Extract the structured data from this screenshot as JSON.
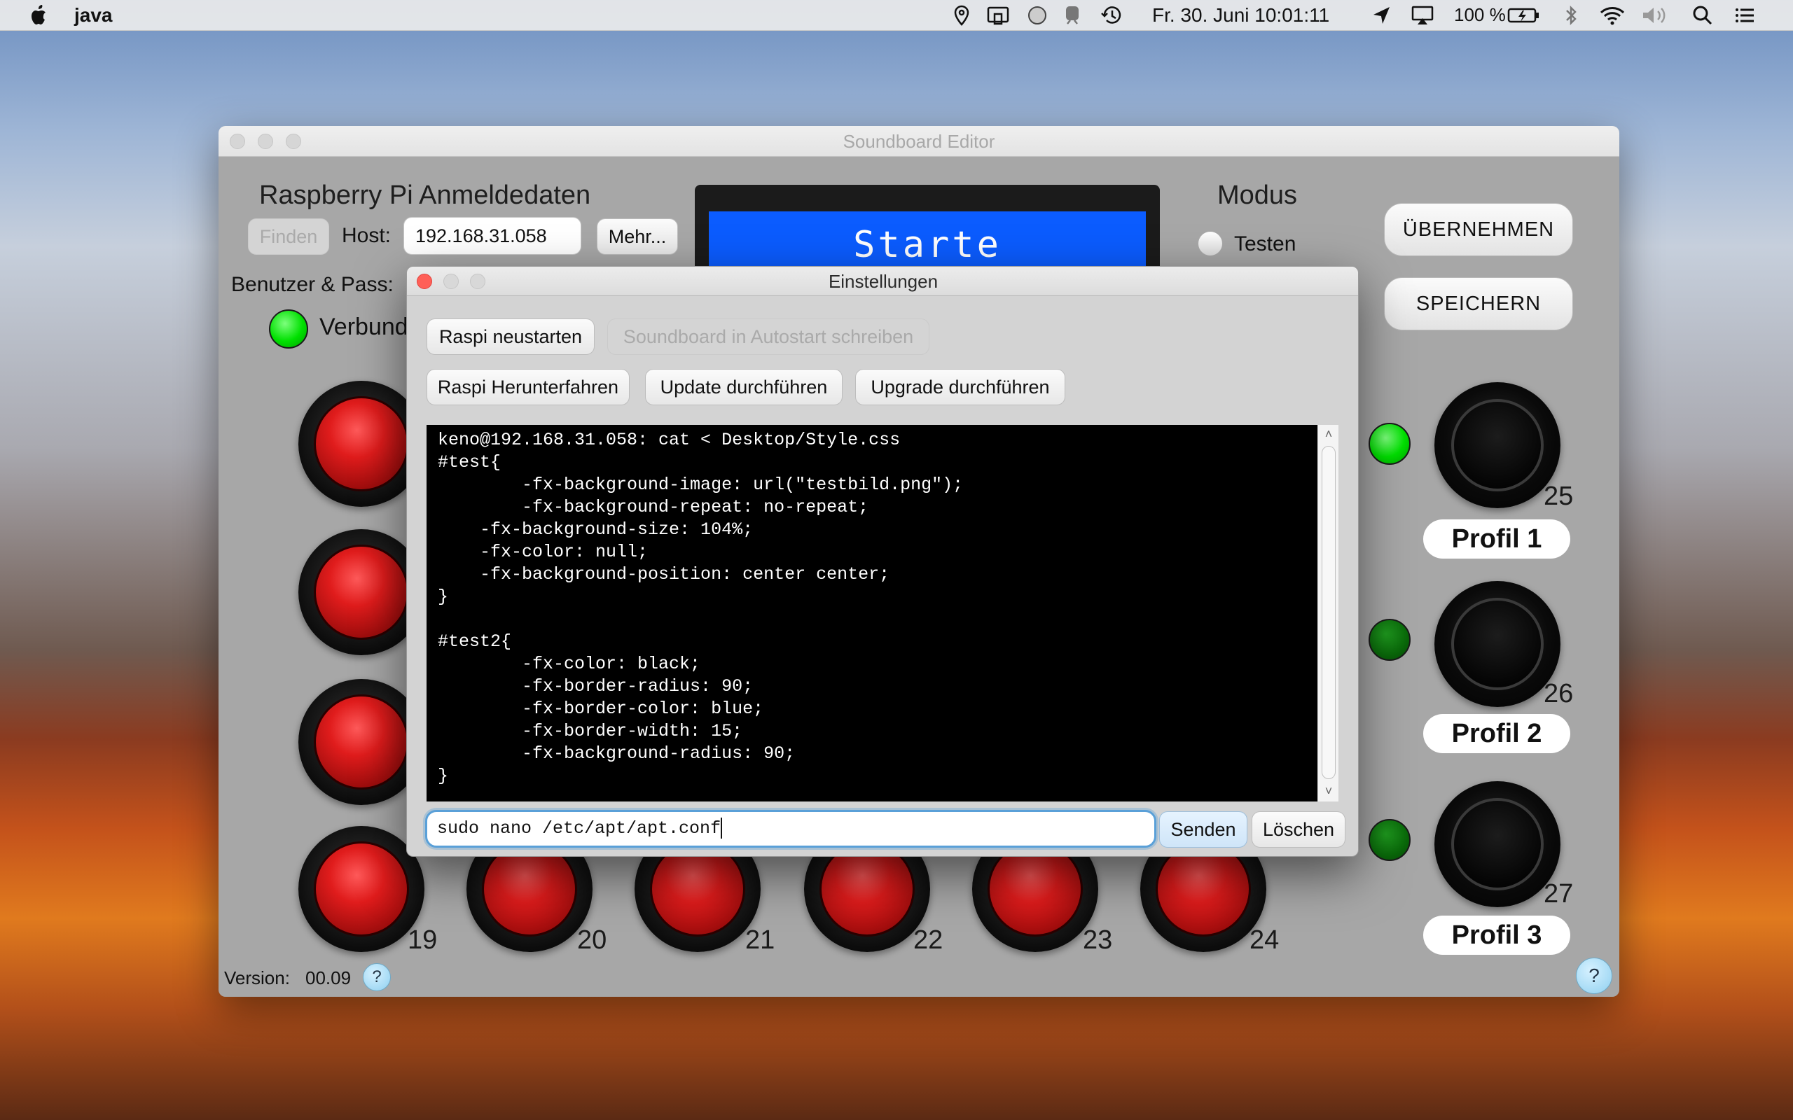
{
  "menubar": {
    "app_name": "java",
    "clock": "Fr. 30. Juni  10:01:11",
    "battery": "100 %",
    "icons": [
      "apple-icon",
      "location-icon",
      "airplay-display-icon",
      "circle-status-icon",
      "train-icon",
      "time-machine-icon",
      "location-arrow-icon",
      "airplay-icon",
      "battery-icon",
      "bluetooth-icon",
      "wifi-icon",
      "volume-icon",
      "spotlight-search-icon",
      "notification-list-icon"
    ]
  },
  "main_window": {
    "title": "Soundboard Editor",
    "pi_section_title": "Raspberry Pi Anmeldedaten",
    "find_button": "Finden",
    "host_label": "Host:",
    "host_value": "192.168.31.058",
    "more_button": "Mehr...",
    "user_pass_label": "Benutzer & Pass:",
    "connected_label": "Verbunden",
    "display_text": "Starte",
    "mode_title": "Modus",
    "mode_test_label": "Testen",
    "apply_button": "ÜBERNEHMEN",
    "save_button": "SPEICHERN",
    "red_buttons": [
      {
        "number": "19"
      },
      {
        "number": "20"
      },
      {
        "number": "21"
      },
      {
        "number": "22"
      },
      {
        "number": "23"
      },
      {
        "number": "24"
      }
    ],
    "profiles": [
      {
        "number": "25",
        "label": "Profil 1",
        "led": "bright-green"
      },
      {
        "number": "26",
        "label": "Profil 2",
        "led": "dark-green"
      },
      {
        "number": "27",
        "label": "Profil 3",
        "led": "dark-green"
      }
    ],
    "version_label": "Version:",
    "version_value": "00.09",
    "help_label": "?"
  },
  "settings_dialog": {
    "title": "Einstellungen",
    "reboot_button": "Raspi neustarten",
    "autostart_button": "Soundboard in Autostart schreiben",
    "shutdown_button": "Raspi Herunterfahren",
    "update_button": "Update durchführen",
    "upgrade_button": "Upgrade durchführen",
    "terminal_output": "keno@192.168.31.058: cat < Desktop/Style.css\n#test{\n        -fx-background-image: url(\"testbild.png\");\n        -fx-background-repeat: no-repeat;\n    -fx-background-size: 104%;\n    -fx-color: null;\n    -fx-background-position: center center;\n}\n\n#test2{\n        -fx-color: black;\n        -fx-border-radius: 90;\n        -fx-border-color: blue;\n        -fx-border-width: 15;\n        -fx-background-radius: 90;\n}",
    "command_value": "sudo nano /etc/apt/apt.conf",
    "send_button": "Senden",
    "clear_button": "Löschen"
  }
}
